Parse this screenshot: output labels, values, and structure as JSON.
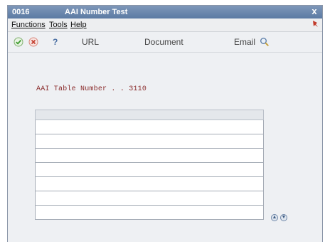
{
  "window": {
    "code": "0016",
    "title": "AAI Number Test",
    "close_glyph": "x"
  },
  "menu": {
    "items": [
      "Functions",
      "Tools",
      "Help"
    ]
  },
  "toolbar": {
    "ok_icon": "check-icon",
    "cancel_icon": "cancel-icon",
    "help_label": "?",
    "url_label": "URL",
    "document_label": "Document",
    "email_label": "Email",
    "search_icon": "search-icon",
    "accent": "#3b9a2c",
    "cancel_color": "#c23a2a"
  },
  "form": {
    "aai_label": "AAI Table Number . . 3110"
  },
  "grid": {
    "rows": 7
  },
  "colors": {
    "title_bar": "#5b7aa3",
    "label_text": "#8a2b2b"
  }
}
